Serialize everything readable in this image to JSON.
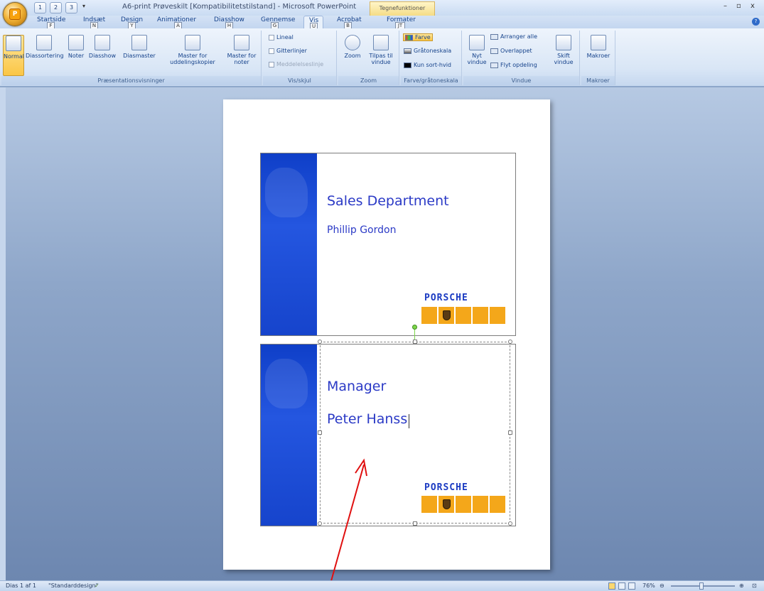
{
  "window": {
    "title": "A6-print Prøveskilt [Kompatibilitetstilstand] - Microsoft PowerPoint",
    "context_tab": "Tegnefunktioner",
    "minimize": "–",
    "restore": "▫",
    "close": "x"
  },
  "office_button": {
    "label": "P"
  },
  "quick_access": [
    {
      "label": "1",
      "icon": "save-icon"
    },
    {
      "label": "2",
      "icon": "undo-icon"
    },
    {
      "label": "3",
      "icon": "redo-icon"
    }
  ],
  "qat_more": "▾",
  "tabs": [
    {
      "label": "Startside",
      "key": "F"
    },
    {
      "label": "Indsæt",
      "key": "N"
    },
    {
      "label": "Design",
      "key": "Y"
    },
    {
      "label": "Animationer",
      "key": "A"
    },
    {
      "label": "Diasshow",
      "key": "H"
    },
    {
      "label": "Gennemse",
      "key": "G"
    },
    {
      "label": "Vis",
      "key": "U"
    },
    {
      "label": "Acrobat",
      "key": "B"
    },
    {
      "label": "Formater",
      "key": "JT"
    }
  ],
  "active_tab": "Vis",
  "ribbon": {
    "groups": {
      "views": "Præsentationsvisninger",
      "showhide": "Vis/skjul",
      "zoom": "Zoom",
      "color": "Farve/gråtoneskala",
      "window": "Vindue",
      "macros": "Makroer"
    },
    "views_buttons": [
      "Normal",
      "Diassortering",
      "Noter",
      "Diasshow",
      "Diasmaster",
      "Master for uddelingskopier",
      "Master for noter"
    ],
    "showhide": [
      "Lineal",
      "Gitterlinjer",
      "Meddelelseslinje"
    ],
    "zoom_buttons": [
      "Zoom",
      "Tilpas til vindue"
    ],
    "color_buttons": [
      "Farve",
      "Gråtoneskala",
      "Kun sort-hvid"
    ],
    "window_buttons": {
      "new": "Nyt vindue",
      "arrange": "Arranger alle",
      "cascade": "Overlappet",
      "split": "Flyt opdeling",
      "switch": "Skift vindue"
    },
    "macros_button": "Makroer"
  },
  "slide": {
    "card1": {
      "line1": "Sales Department",
      "line2": "Phillip Gordon",
      "brand": "PORSCHE"
    },
    "card2": {
      "line1": "Manager",
      "line2": "Peter Hanss",
      "brand": "PORSCHE"
    }
  },
  "statusbar": {
    "slide": "Dias 1 af 1",
    "theme": "\"Standarddesign\"",
    "zoom": "76%",
    "zoom_minus": "⊖",
    "zoom_plus": "⊕"
  },
  "colors": {
    "accent": "#2b3ac6",
    "tile": "#f4a71a",
    "arrow": "#e01010"
  }
}
